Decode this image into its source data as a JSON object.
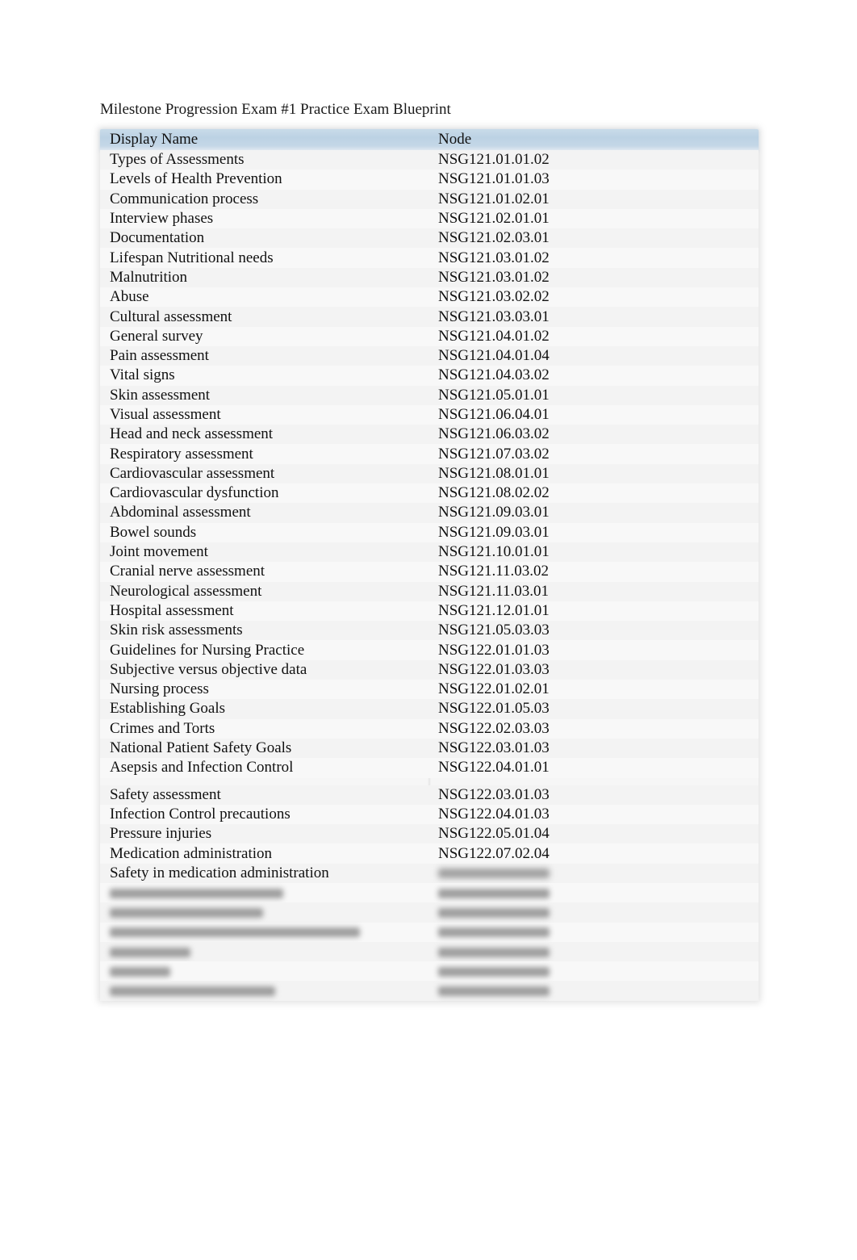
{
  "document": {
    "title": "Milestone Progression Exam #1 Practice Exam Blueprint"
  },
  "table": {
    "columns": [
      "Display Name",
      "Node"
    ],
    "rows": [
      {
        "name": "Types of Assessments",
        "node": "NSG121.01.01.02"
      },
      {
        "name": "Levels of Health Prevention",
        "node": "NSG121.01.01.03"
      },
      {
        "name": "Communication process",
        "node": "NSG121.01.02.01"
      },
      {
        "name": "Interview phases",
        "node": "NSG121.02.01.01"
      },
      {
        "name": "Documentation",
        "node": "NSG121.02.03.01"
      },
      {
        "name": "Lifespan Nutritional needs",
        "node": "NSG121.03.01.02"
      },
      {
        "name": "Malnutrition",
        "node": "NSG121.03.01.02"
      },
      {
        "name": "Abuse",
        "node": "NSG121.03.02.02"
      },
      {
        "name": "Cultural assessment",
        "node": "NSG121.03.03.01"
      },
      {
        "name": "General survey",
        "node": "NSG121.04.01.02"
      },
      {
        "name": "Pain assessment",
        "node": "NSG121.04.01.04"
      },
      {
        "name": "Vital signs",
        "node": "NSG121.04.03.02"
      },
      {
        "name": "Skin assessment",
        "node": "NSG121.05.01.01"
      },
      {
        "name": "Visual assessment",
        "node": "NSG121.06.04.01"
      },
      {
        "name": "Head and neck assessment",
        "node": "NSG121.06.03.02"
      },
      {
        "name": "Respiratory assessment",
        "node": "NSG121.07.03.02"
      },
      {
        "name": "Cardiovascular assessment",
        "node": "NSG121.08.01.01"
      },
      {
        "name": "Cardiovascular dysfunction",
        "node": "NSG121.08.02.02"
      },
      {
        "name": "Abdominal assessment",
        "node": "NSG121.09.03.01"
      },
      {
        "name": "Bowel sounds",
        "node": "NSG121.09.03.01"
      },
      {
        "name": "Joint movement",
        "node": "NSG121.10.01.01"
      },
      {
        "name": "Cranial nerve assessment",
        "node": "NSG121.11.03.02"
      },
      {
        "name": "Neurological assessment",
        "node": "NSG121.11.03.01"
      },
      {
        "name": "Hospital assessment",
        "node": "NSG121.12.01.01"
      },
      {
        "name": "Skin risk assessments",
        "node": "NSG121.05.03.03"
      },
      {
        "name": "Guidelines for Nursing Practice",
        "node": "NSG122.01.01.03"
      },
      {
        "name": "Subjective versus objective data",
        "node": "NSG122.01.03.03"
      },
      {
        "name": "Nursing process",
        "node": "NSG122.01.02.01"
      },
      {
        "name": "Establishing Goals",
        "node": "NSG122.01.05.03"
      },
      {
        "name": "Crimes and Torts",
        "node": "NSG122.02.03.03"
      },
      {
        "name": "National Patient Safety Goals",
        "node": "NSG122.03.01.03"
      },
      {
        "name": "Asepsis and Infection Control",
        "node": "NSG122.04.01.01"
      },
      {
        "name": "Safety assessment",
        "node": "NSG122.03.01.03"
      },
      {
        "name": "Infection Control precautions",
        "node": "NSG122.04.01.03"
      },
      {
        "name": "Pressure injuries",
        "node": "NSG122.05.01.04"
      },
      {
        "name": "Medication administration",
        "node": "NSG122.07.02.04"
      },
      {
        "name": "Safety in medication administration",
        "node": ""
      }
    ],
    "blurred_row_count": 6
  }
}
